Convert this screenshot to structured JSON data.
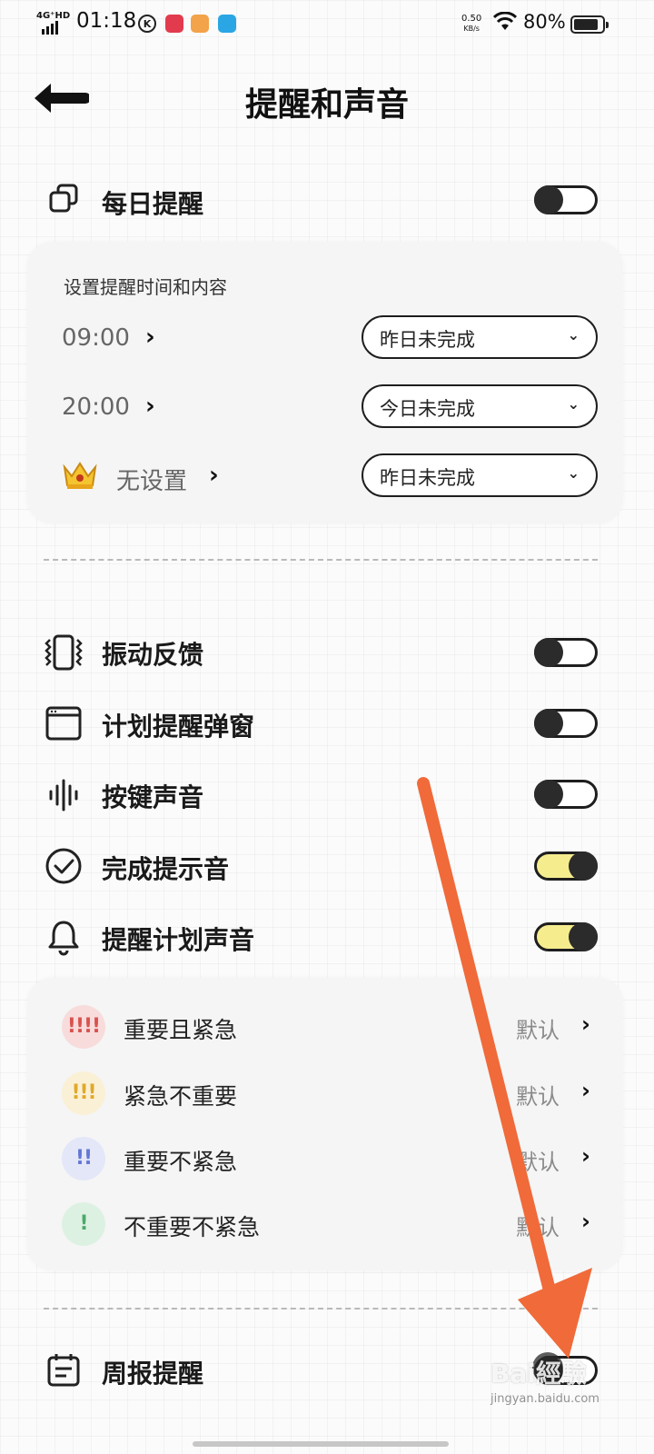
{
  "status_bar": {
    "network": "4G⁺HD",
    "time": "01:18",
    "net_speed": "0.50",
    "net_speed_unit": "KB/s",
    "battery": "80%",
    "battery_level": 0.8
  },
  "header": {
    "title": "提醒和声音"
  },
  "daily_reminder": {
    "label": "每日提醒",
    "enabled": false,
    "card_title": "设置提醒时间和内容",
    "slots": [
      {
        "time": "09:00",
        "content": "昨日未完成"
      },
      {
        "time": "20:00",
        "content": "今日未完成"
      },
      {
        "time": "无设置",
        "content": "昨日未完成",
        "icon": "crown-icon"
      }
    ]
  },
  "settings": [
    {
      "label": "振动反馈",
      "icon": "vibration-icon",
      "enabled": false
    },
    {
      "label": "计划提醒弹窗",
      "icon": "popup-window-icon",
      "enabled": false
    },
    {
      "label": "按键声音",
      "icon": "sound-wave-icon",
      "enabled": false
    },
    {
      "label": "完成提示音",
      "icon": "check-circle-icon",
      "enabled": true
    },
    {
      "label": "提醒计划声音",
      "icon": "bell-icon",
      "enabled": true
    }
  ],
  "priorities": [
    {
      "badge": "!!!!",
      "label": "重要且紧急",
      "value": "默认",
      "color": "#d9534f",
      "bg": "#f8dcdc"
    },
    {
      "badge": "!!!",
      "label": "紧急不重要",
      "value": "默认",
      "color": "#e0a92a",
      "bg": "#faf0d6"
    },
    {
      "badge": "!!",
      "label": "重要不紧急",
      "value": "默认",
      "color": "#6577d4",
      "bg": "#e3e7f8"
    },
    {
      "badge": "!",
      "label": "不重要不紧急",
      "value": "默认",
      "color": "#4caa6a",
      "bg": "#ddf1e3"
    }
  ],
  "weekly_report": {
    "label": "周报提醒",
    "enabled": false
  },
  "overlay": {
    "arrow_color": "#f06a3a",
    "watermark": "Bai經驗",
    "watermark_sub": "jingyan.baidu.com"
  },
  "colors": {
    "toggle_on": "#f5ec8e",
    "toggle_knob": "#2b2b2b"
  }
}
